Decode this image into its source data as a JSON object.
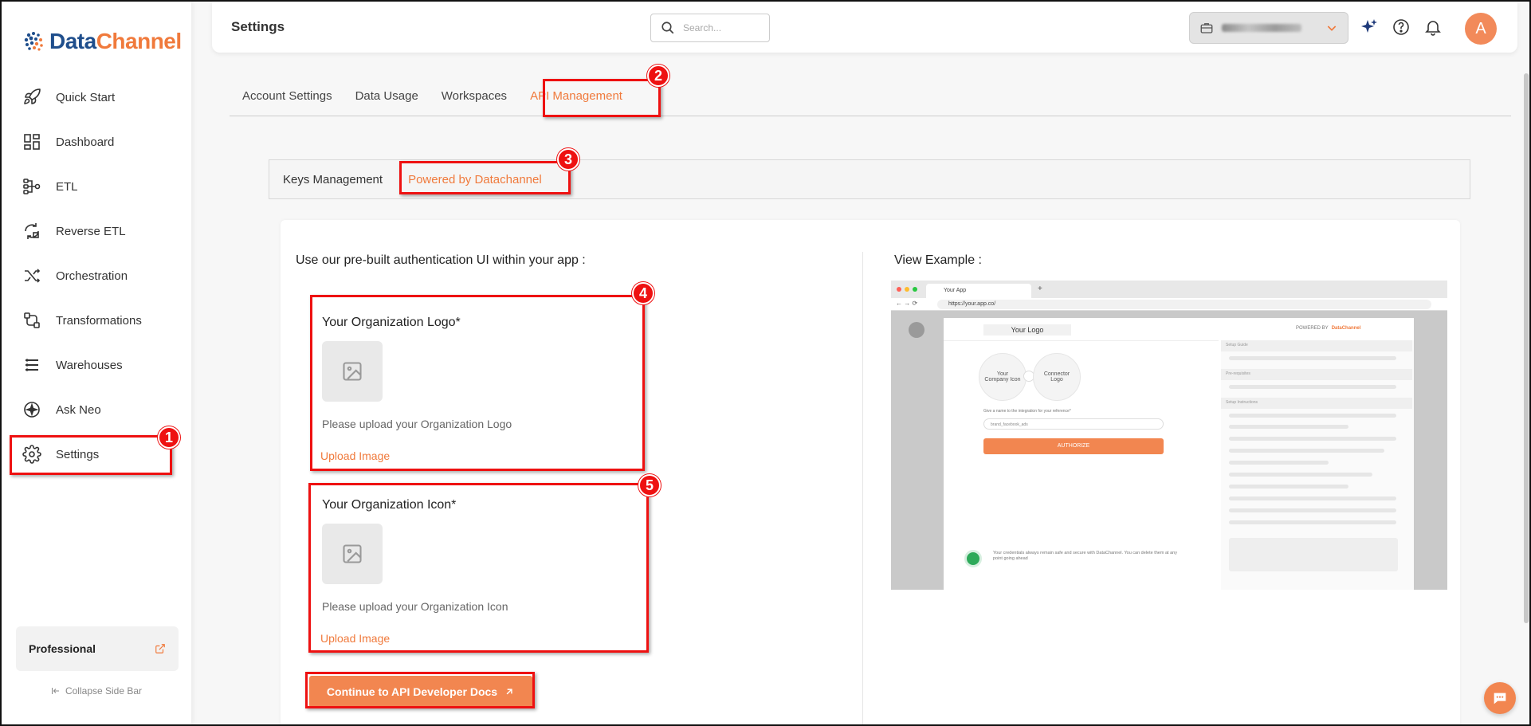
{
  "app": {
    "brand_left": "Data",
    "brand_right": "Channel",
    "accent_color": "#f07a3c",
    "brand_blue": "#1f4e8c"
  },
  "sidebar": {
    "items": [
      {
        "label": "Quick Start",
        "icon": "rocket-icon"
      },
      {
        "label": "Dashboard",
        "icon": "dashboard-icon"
      },
      {
        "label": "ETL",
        "icon": "etl-icon"
      },
      {
        "label": "Reverse ETL",
        "icon": "reverse-etl-icon"
      },
      {
        "label": "Orchestration",
        "icon": "orchestration-icon"
      },
      {
        "label": "Transformations",
        "icon": "transformations-icon"
      },
      {
        "label": "Warehouses",
        "icon": "warehouses-icon"
      },
      {
        "label": "Ask Neo",
        "icon": "sparkle-icon"
      },
      {
        "label": "Settings",
        "icon": "gear-icon"
      }
    ],
    "plan": "Professional",
    "collapse_label": "Collapse Side Bar"
  },
  "header": {
    "title": "Settings",
    "search_placeholder": "Search..."
  },
  "tabs": [
    "Account Settings",
    "Data Usage",
    "Workspaces",
    "API Management"
  ],
  "subtabs": [
    "Keys Management",
    "Powered by Datachannel"
  ],
  "content": {
    "left_title": "Use our pre-built authentication UI within your app :",
    "logo_title": "Your Organization Logo*",
    "logo_hint": "Please upload your Organization Logo",
    "icon_title": "Your Organization Icon*",
    "icon_hint": "Please upload your Organization Icon",
    "upload_label": "Upload Image",
    "cta_label": "Continue to API Developer Docs",
    "right_title": "View Example :"
  },
  "preview": {
    "tab_title": "Your App",
    "url": "https://your.app.co/",
    "your_logo": "Your Logo",
    "powered_by": "POWERED BY",
    "powered_brand": "DataChannel",
    "company_icon": "Your Company Icon",
    "connector_logo": "Connector Logo",
    "name_prompt": "Give a name to the integration for your reference*",
    "name_value": "brand_facebook_ads",
    "authorize": "AUTHORIZE",
    "security_note": "Your credentials always remain safe and secure with DataChannel. You can delete them at any point going ahead",
    "setup_guide": "Setup Guide",
    "pre_requisites": "Pre-requisites",
    "setup_instructions": "Setup Instructions"
  },
  "annotations": [
    "1",
    "2",
    "3",
    "4",
    "5"
  ]
}
